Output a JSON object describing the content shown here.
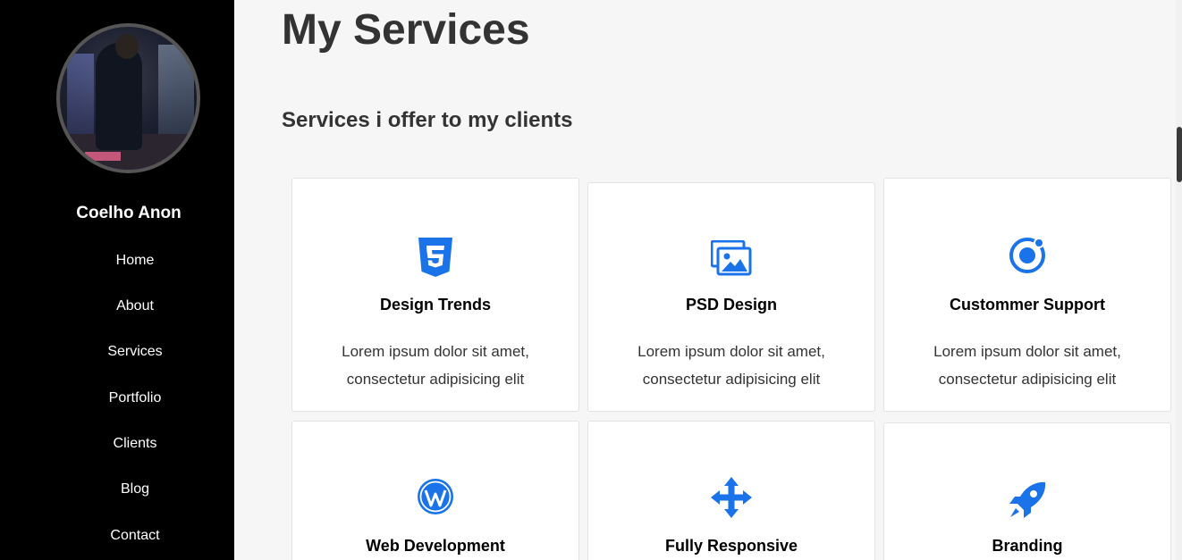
{
  "sidebar": {
    "name": "Coelho Anon",
    "nav": [
      "Home",
      "About",
      "Services",
      "Portfolio",
      "Clients",
      "Blog",
      "Contact"
    ]
  },
  "main": {
    "title": "My Services",
    "subtitle": "Services i offer to my clients"
  },
  "services": [
    {
      "title": "Design Trends",
      "icon": "css3-icon",
      "desc1": "Lorem ipsum dolor sit amet,",
      "desc2": "consectetur adipisicing elit"
    },
    {
      "title": "PSD Design",
      "icon": "images-icon",
      "desc1": "Lorem ipsum dolor sit amet,",
      "desc2": "consectetur adipisicing elit"
    },
    {
      "title": "Custommer Support",
      "icon": "ionic-icon",
      "desc1": "Lorem ipsum dolor sit amet,",
      "desc2": "consectetur adipisicing elit"
    },
    {
      "title": "Web Development",
      "icon": "wordpress-icon"
    },
    {
      "title": "Fully Responsive",
      "icon": "arrows-move-icon"
    },
    {
      "title": "Branding",
      "icon": "rocket-icon"
    }
  ],
  "colors": {
    "accent": "#1a73e8",
    "sidebar_bg": "#000000",
    "page_bg": "#f6f6f6"
  }
}
